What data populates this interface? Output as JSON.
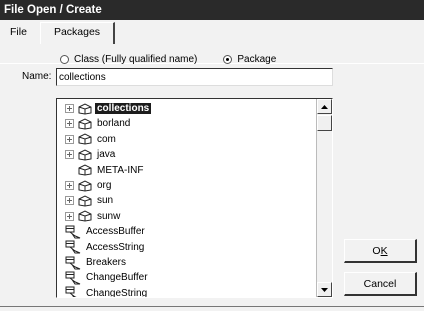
{
  "window": {
    "title": "File Open / Create"
  },
  "tabs": [
    {
      "label": "File",
      "active": false
    },
    {
      "label": "Packages",
      "active": true
    }
  ],
  "radio_options": [
    {
      "label": "Class (Fully qualified name)",
      "selected": false
    },
    {
      "label": "Package",
      "selected": true
    }
  ],
  "name_field": {
    "label": "Name:",
    "value": "collections"
  },
  "tree": {
    "items": [
      {
        "label": "collections",
        "kind": "package",
        "expandable": true,
        "selected": true
      },
      {
        "label": "borland",
        "kind": "package",
        "expandable": true,
        "selected": false
      },
      {
        "label": "com",
        "kind": "package",
        "expandable": true,
        "selected": false
      },
      {
        "label": "java",
        "kind": "package",
        "expandable": true,
        "selected": false
      },
      {
        "label": "META-INF",
        "kind": "package",
        "expandable": false,
        "selected": false
      },
      {
        "label": "org",
        "kind": "package",
        "expandable": true,
        "selected": false
      },
      {
        "label": "sun",
        "kind": "package",
        "expandable": true,
        "selected": false
      },
      {
        "label": "sunw",
        "kind": "package",
        "expandable": true,
        "selected": false
      },
      {
        "label": "AccessBuffer",
        "kind": "class",
        "expandable": false,
        "selected": false
      },
      {
        "label": "AccessString",
        "kind": "class",
        "expandable": false,
        "selected": false
      },
      {
        "label": "Breakers",
        "kind": "class",
        "expandable": false,
        "selected": false
      },
      {
        "label": "ChangeBuffer",
        "kind": "class",
        "expandable": false,
        "selected": false
      },
      {
        "label": "ChangeString",
        "kind": "class",
        "expandable": false,
        "selected": false
      }
    ]
  },
  "buttons": {
    "ok": {
      "label_pre": "O",
      "label_acc": "K"
    },
    "cancel": {
      "label": "Cancel"
    }
  },
  "icons": {
    "package": "package-icon",
    "class": "class-icon",
    "expander": "plus-box-icon",
    "scroll_up": "triangle-up-icon",
    "scroll_down": "triangle-down-icon"
  },
  "colors": {
    "titlebar": "#2a2a2a",
    "selection": "#1c1c1c",
    "window_bg": "#f2f2f2"
  }
}
